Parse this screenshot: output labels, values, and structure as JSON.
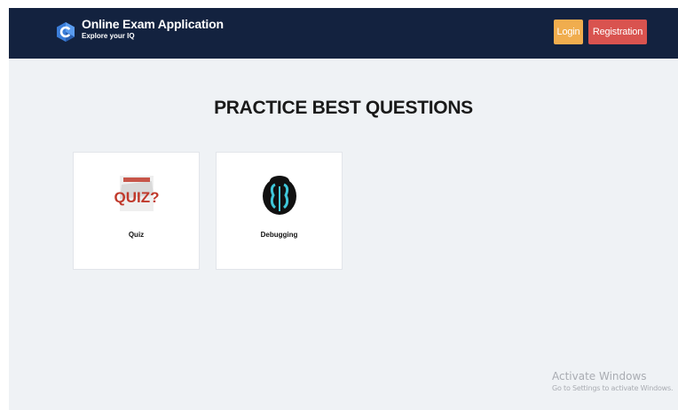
{
  "navbar": {
    "title": "Online Exam Application",
    "subtitle": "Explore your IQ",
    "logo_icon": "c-language-logo-icon",
    "login_label": "Login",
    "registration_label": "Registration",
    "colors": {
      "background": "#13223f",
      "login": "#f0ad4e",
      "registration": "#d9534f"
    }
  },
  "main": {
    "heading": "PRACTICE BEST QUESTIONS",
    "cards": [
      {
        "label": "Quiz",
        "icon": "quiz-image-icon",
        "image_text": "QUIZ?"
      },
      {
        "label": "Debugging",
        "icon": "bug-icon"
      }
    ]
  },
  "watermark": {
    "title": "Activate Windows",
    "subtitle": "Go to Settings to activate Windows."
  }
}
